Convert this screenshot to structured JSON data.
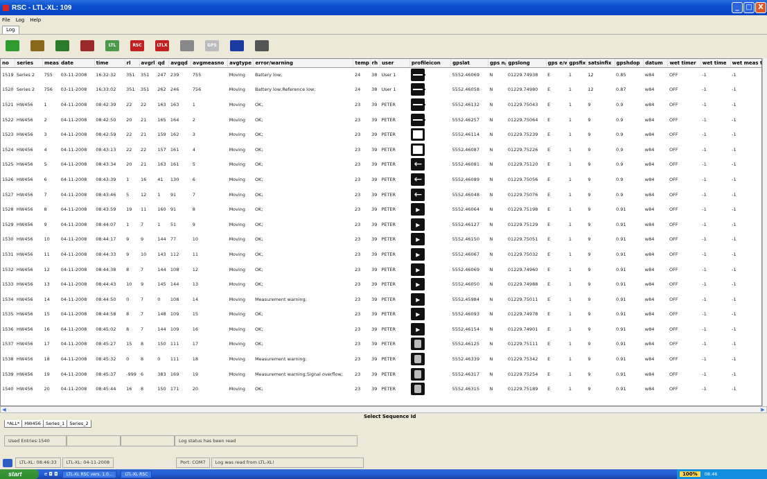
{
  "window": {
    "title": "RSC - LTL-XL: 109",
    "min": "_",
    "max": "□",
    "close": "X"
  },
  "menu": [
    "File",
    "Log",
    "Help"
  ],
  "log_tab": "Log",
  "toolbar": [
    {
      "name": "download-icon",
      "color": "#2e9b2e",
      "text": ""
    },
    {
      "name": "device-icon",
      "color": "#8a6a1a",
      "text": ""
    },
    {
      "name": "save-icon",
      "color": "#2a7a2a",
      "text": ""
    },
    {
      "name": "save-red-icon",
      "color": "#9a2a2a",
      "text": ""
    },
    {
      "name": "ltl-icon",
      "color": "#4a9a4a",
      "text": "LTL"
    },
    {
      "name": "rsc-delete-icon",
      "color": "#c02020",
      "text": "RSC"
    },
    {
      "name": "ltlx-delete-icon",
      "color": "#c02020",
      "text": "LTLX"
    },
    {
      "name": "eraser-icon",
      "color": "#888888",
      "text": ""
    },
    {
      "name": "gps-icon",
      "color": "#bbbbbb",
      "text": "GPS"
    },
    {
      "name": "globe-icon",
      "color": "#1a3aa0",
      "text": ""
    },
    {
      "name": "globe-gray-icon",
      "color": "#555555",
      "text": ""
    }
  ],
  "columns": [
    "no",
    "series",
    "meas",
    "date",
    "time",
    "rl",
    "avgrl",
    "qd",
    "avgqd",
    "avgmeasno",
    "avgtype",
    "error/warning",
    "temp",
    "rh",
    "user",
    "profileicon",
    "gpslat",
    "gps n/s",
    "gpslong",
    "gps e/w",
    "gpsfix",
    "satsinfix",
    "gpshdop",
    "datum",
    "wet timer",
    "wet time",
    "wet meas tin"
  ],
  "rows": [
    [
      "1519",
      "Series 2",
      "755",
      "03-11-2008",
      "16:32:32",
      "351",
      "351",
      "247",
      "239",
      "755",
      "Moving",
      "Battery low;",
      "24",
      "38",
      "User 1",
      "dash",
      "5552.46069",
      "N",
      "01229.74938",
      "E",
      "1",
      "12",
      "0.85",
      "w84",
      "OFF",
      "-1",
      "-1"
    ],
    [
      "1520",
      "Series 2",
      "756",
      "03-11-2008",
      "16:33:02",
      "351",
      "351",
      "262",
      "246",
      "756",
      "Moving",
      "Battery low;Reference low;",
      "24",
      "38",
      "User 1",
      "dash",
      "5552.46058",
      "N",
      "01229.74980",
      "E",
      "1",
      "12",
      "0.87",
      "w84",
      "OFF",
      "-1",
      "-1"
    ],
    [
      "1521",
      "HW456",
      "1",
      "04-11-2008",
      "08:42:39",
      "22",
      "22",
      "163",
      "163",
      "1",
      "Moving",
      "OK;",
      "23",
      "39",
      "PETER",
      "dash",
      "5552.46132",
      "N",
      "01229.75043",
      "E",
      "1",
      "9",
      "0.9",
      "w84",
      "OFF",
      "-1",
      "-1"
    ],
    [
      "1522",
      "HW456",
      "2",
      "04-11-2008",
      "08:42:50",
      "20",
      "21",
      "165",
      "164",
      "2",
      "Moving",
      "OK;",
      "23",
      "39",
      "PETER",
      "dash",
      "5552.46257",
      "N",
      "01229.75064",
      "E",
      "1",
      "9",
      "0.9",
      "w84",
      "OFF",
      "-1",
      "-1"
    ],
    [
      "1523",
      "HW456",
      "3",
      "04-11-2008",
      "08:42:59",
      "22",
      "21",
      "159",
      "162",
      "3",
      "Moving",
      "OK;",
      "23",
      "39",
      "PETER",
      "box",
      "5552.46114",
      "N",
      "01229.75239",
      "E",
      "1",
      "9",
      "0.9",
      "w84",
      "OFF",
      "-1",
      "-1"
    ],
    [
      "1524",
      "HW456",
      "4",
      "04-11-2008",
      "08:43:13",
      "22",
      "22",
      "157",
      "161",
      "4",
      "Moving",
      "OK;",
      "23",
      "39",
      "PETER",
      "box",
      "5552.46087",
      "N",
      "01229.75226",
      "E",
      "1",
      "9",
      "0.9",
      "w84",
      "OFF",
      "-1",
      "-1"
    ],
    [
      "1525",
      "HW456",
      "5",
      "04-11-2008",
      "08:43:34",
      "20",
      "21",
      "163",
      "161",
      "5",
      "Moving",
      "OK;",
      "23",
      "39",
      "PETER",
      "left",
      "5552.46081",
      "N",
      "01229.75120",
      "E",
      "1",
      "9",
      "0.9",
      "w84",
      "OFF",
      "-1",
      "-1"
    ],
    [
      "1526",
      "HW456",
      "6",
      "04-11-2008",
      "08:43:39",
      "1",
      "16",
      "41",
      "130",
      "6",
      "Moving",
      "OK;",
      "23",
      "39",
      "PETER",
      "left",
      "5552.46089",
      "N",
      "01229.75056",
      "E",
      "1",
      "9",
      "0.9",
      "w84",
      "OFF",
      "-1",
      "-1"
    ],
    [
      "1527",
      "HW456",
      "7",
      "04-11-2008",
      "08:43:46",
      "5",
      "12",
      "1",
      "91",
      "7",
      "Moving",
      "OK;",
      "23",
      "39",
      "PETER",
      "left",
      "5552.46048",
      "N",
      "01229.75076",
      "E",
      "1",
      "9",
      "0.9",
      "w84",
      "OFF",
      "-1",
      "-1"
    ],
    [
      "1528",
      "HW456",
      "8",
      "04-11-2008",
      "08:43:59",
      "19",
      "11",
      "160",
      "91",
      "8",
      "Moving",
      "OK;",
      "23",
      "39",
      "PETER",
      "right",
      "5552.46064",
      "N",
      "01229.75198",
      "E",
      "1",
      "9",
      "0.91",
      "w84",
      "OFF",
      "-1",
      "-1"
    ],
    [
      "1529",
      "HW456",
      "9",
      "04-11-2008",
      "08:44:07",
      "1",
      "7",
      "1",
      "51",
      "9",
      "Moving",
      "OK;",
      "23",
      "39",
      "PETER",
      "right",
      "5552.46127",
      "N",
      "01229.75129",
      "E",
      "1",
      "9",
      "0.91",
      "w84",
      "OFF",
      "-1",
      "-1"
    ],
    [
      "1530",
      "HW456",
      "10",
      "04-11-2008",
      "08:44:17",
      "9",
      "9",
      "144",
      "77",
      "10",
      "Moving",
      "OK;",
      "23",
      "39",
      "PETER",
      "right",
      "5552.46150",
      "N",
      "01229.75051",
      "E",
      "1",
      "9",
      "0.91",
      "w84",
      "OFF",
      "-1",
      "-1"
    ],
    [
      "1531",
      "HW456",
      "11",
      "04-11-2008",
      "08:44:33",
      "9",
      "10",
      "143",
      "112",
      "11",
      "Moving",
      "OK;",
      "23",
      "39",
      "PETER",
      "right",
      "5552.46067",
      "N",
      "01229.75032",
      "E",
      "1",
      "9",
      "0.91",
      "w84",
      "OFF",
      "-1",
      "-1"
    ],
    [
      "1532",
      "HW456",
      "12",
      "04-11-2008",
      "08:44:38",
      "8",
      "7",
      "144",
      "108",
      "12",
      "Moving",
      "OK;",
      "23",
      "39",
      "PETER",
      "right",
      "5552.46069",
      "N",
      "01229.74960",
      "E",
      "1",
      "9",
      "0.91",
      "w84",
      "OFF",
      "-1",
      "-1"
    ],
    [
      "1533",
      "HW456",
      "13",
      "04-11-2008",
      "08:44:43",
      "10",
      "9",
      "145",
      "144",
      "13",
      "Moving",
      "OK;",
      "23",
      "39",
      "PETER",
      "right",
      "5552.46050",
      "N",
      "01229.74988",
      "E",
      "1",
      "9",
      "0.91",
      "w84",
      "OFF",
      "-1",
      "-1"
    ],
    [
      "1534",
      "HW456",
      "14",
      "04-11-2008",
      "08:44:50",
      "0",
      "7",
      "0",
      "108",
      "14",
      "Moving",
      "Measurement warning;",
      "23",
      "39",
      "PETER",
      "right",
      "5552.45984",
      "N",
      "01229.75011",
      "E",
      "1",
      "9",
      "0.91",
      "w84",
      "OFF",
      "-1",
      "-1"
    ],
    [
      "1535",
      "HW456",
      "15",
      "04-11-2008",
      "08:44:58",
      "8",
      "7",
      "148",
      "109",
      "15",
      "Moving",
      "OK;",
      "23",
      "39",
      "PETER",
      "right",
      "5552.46093",
      "N",
      "01229.74978",
      "E",
      "1",
      "9",
      "0.91",
      "w84",
      "OFF",
      "-1",
      "-1"
    ],
    [
      "1536",
      "HW456",
      "16",
      "04-11-2008",
      "08:45:02",
      "8",
      "7",
      "144",
      "109",
      "16",
      "Moving",
      "OK;",
      "23",
      "39",
      "PETER",
      "right",
      "5552.46154",
      "N",
      "01229.74901",
      "E",
      "1",
      "9",
      "0.91",
      "w84",
      "OFF",
      "-1",
      "-1"
    ],
    [
      "1537",
      "HW456",
      "17",
      "04-11-2008",
      "08:45:27",
      "15",
      "8",
      "150",
      "111",
      "17",
      "Moving",
      "OK;",
      "23",
      "39",
      "PETER",
      "map",
      "5552.46125",
      "N",
      "01229.75111",
      "E",
      "1",
      "9",
      "0.91",
      "w84",
      "OFF",
      "-1",
      "-1"
    ],
    [
      "1538",
      "HW456",
      "18",
      "04-11-2008",
      "08:45:32",
      "0",
      "8",
      "0",
      "111",
      "18",
      "Moving",
      "Measurement warning;",
      "23",
      "39",
      "PETER",
      "map",
      "5552.46339",
      "N",
      "01229.75342",
      "E",
      "1",
      "9",
      "0.91",
      "w84",
      "OFF",
      "-1",
      "-1"
    ],
    [
      "1539",
      "HW456",
      "19",
      "04-11-2008",
      "08:45:37",
      "-999",
      "6",
      "383",
      "169",
      "19",
      "Moving",
      "Measurement warning;Signal overflow;",
      "23",
      "39",
      "PETER",
      "map",
      "5552.46317",
      "N",
      "01229.75254",
      "E",
      "1",
      "9",
      "0.91",
      "w84",
      "OFF",
      "-1",
      "-1"
    ],
    [
      "1540",
      "HW456",
      "20",
      "04-11-2008",
      "08:45:44",
      "16",
      "8",
      "150",
      "171",
      "20",
      "Moving",
      "OK;",
      "23",
      "39",
      "PETER",
      "map",
      "5552.46315",
      "N",
      "01229.75189",
      "E",
      "1",
      "9",
      "0.91",
      "w84",
      "OFF",
      "-1",
      "-1"
    ]
  ],
  "seq_label": "Select Sequence Id",
  "sheet_tabs": [
    "*ALL*",
    "HW456",
    "Series_1",
    "Series_2"
  ],
  "status1": {
    "entries": "Used Entries:1540",
    "message": "Log status has been read"
  },
  "status2": {
    "time": "LTL-XL: 08:46:33",
    "date": "LTL-XL: 04-11-2008",
    "port": "Port: COM7",
    "message": "Log was read from LTL-XL!"
  },
  "taskbar": {
    "start": "start",
    "ql": "e  ◘  ◘",
    "btn1": "LTL-XL RSC vers. 1.0...",
    "btn2": "LTL-XL RSC",
    "zoom": "100%",
    "clock": "08:46"
  }
}
